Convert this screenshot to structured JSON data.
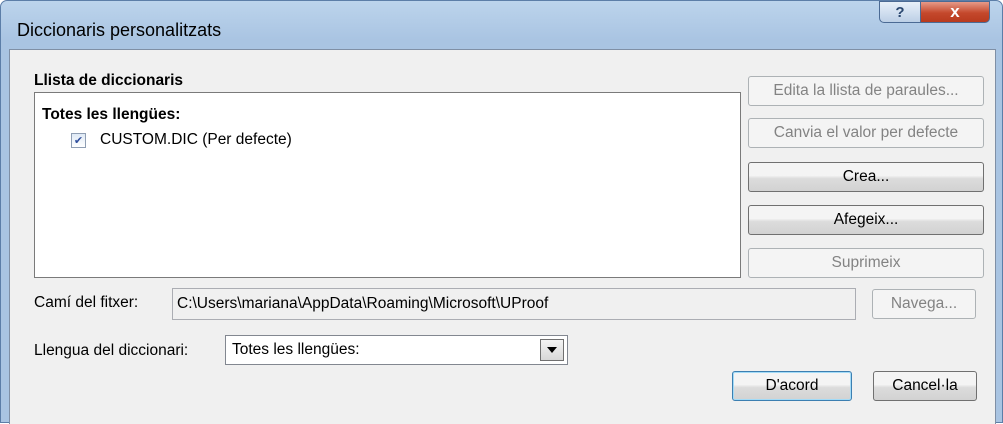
{
  "window": {
    "title": "Diccionaris personalitzats",
    "help_label": "?",
    "close_label": "x"
  },
  "list": {
    "label": "Llista de diccionaris",
    "group": "Totes les llengües:",
    "items": [
      {
        "label": "CUSTOM.DIC (Per defecte)",
        "checked": true
      }
    ]
  },
  "buttons": {
    "edit": "Edita la llista de paraules...",
    "default": "Canvia el valor per defecte",
    "create": "Crea...",
    "add": "Afegeix...",
    "remove": "Suprimeix",
    "browse": "Navega...",
    "ok": "D'acord",
    "cancel": "Cancel·la"
  },
  "path": {
    "label": "Camí del fitxer:",
    "value": "C:\\Users\\mariana\\AppData\\Roaming\\Microsoft\\UProof"
  },
  "language": {
    "label": "Llengua del diccionari:",
    "value": "Totes les llengües:"
  },
  "icons": {
    "checkbox": "checkmark-icon",
    "dropdown": "chevron-down-icon"
  },
  "colors": {
    "titlebar": "#a9c4e2",
    "close": "#c4482c",
    "dialog": "#f0f0f0"
  }
}
